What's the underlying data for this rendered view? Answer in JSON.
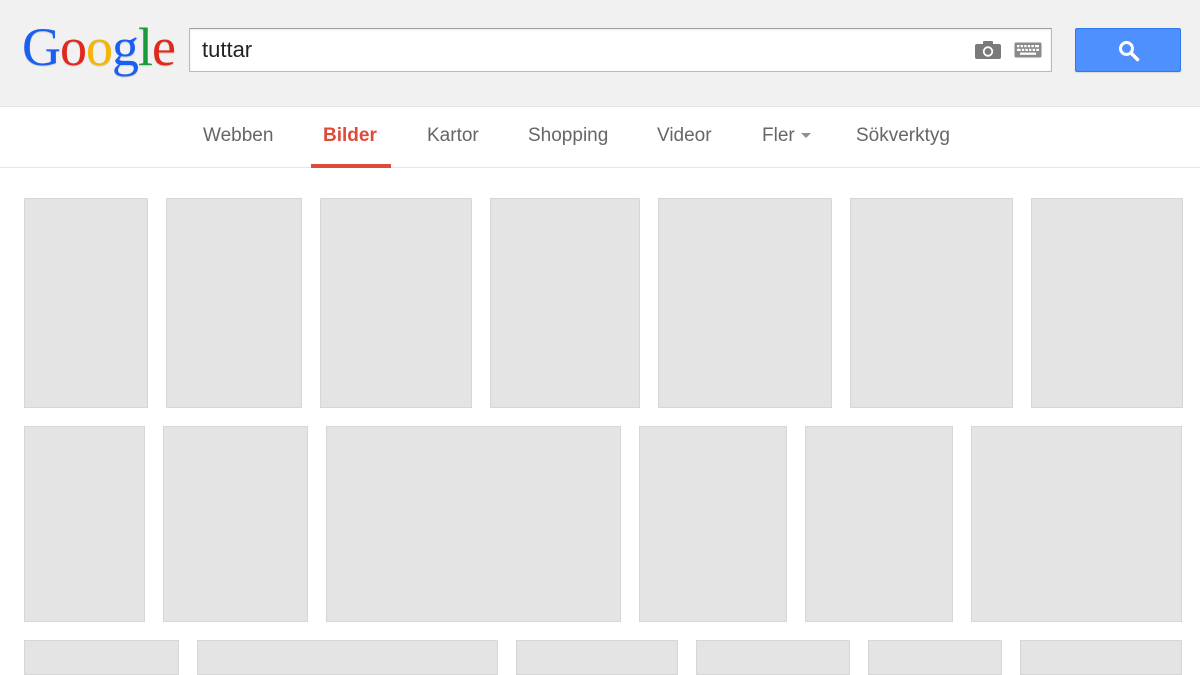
{
  "header": {
    "logo_letters": [
      "G",
      "o",
      "o",
      "g",
      "l",
      "e"
    ],
    "logo_colors": [
      "#1a5ff0",
      "#e0281d",
      "#f6b500",
      "#1a5ff0",
      "#199b39",
      "#e0281d"
    ],
    "search_value": "tuttar",
    "camera_icon": "camera-icon",
    "keyboard_icon": "keyboard-icon",
    "search_button_icon": "search-icon",
    "accent_color": "#4d90fe"
  },
  "tabs": [
    {
      "label": "Webben"
    },
    {
      "label": "Bilder",
      "active": true
    },
    {
      "label": "Kartor"
    },
    {
      "label": "Shopping"
    },
    {
      "label": "Videor"
    },
    {
      "label": "Fler"
    },
    {
      "label": "Sökverktyg"
    }
  ],
  "active_tab_color": "#dd4b39",
  "results": {
    "placeholder_color": "#e4e4e4"
  }
}
